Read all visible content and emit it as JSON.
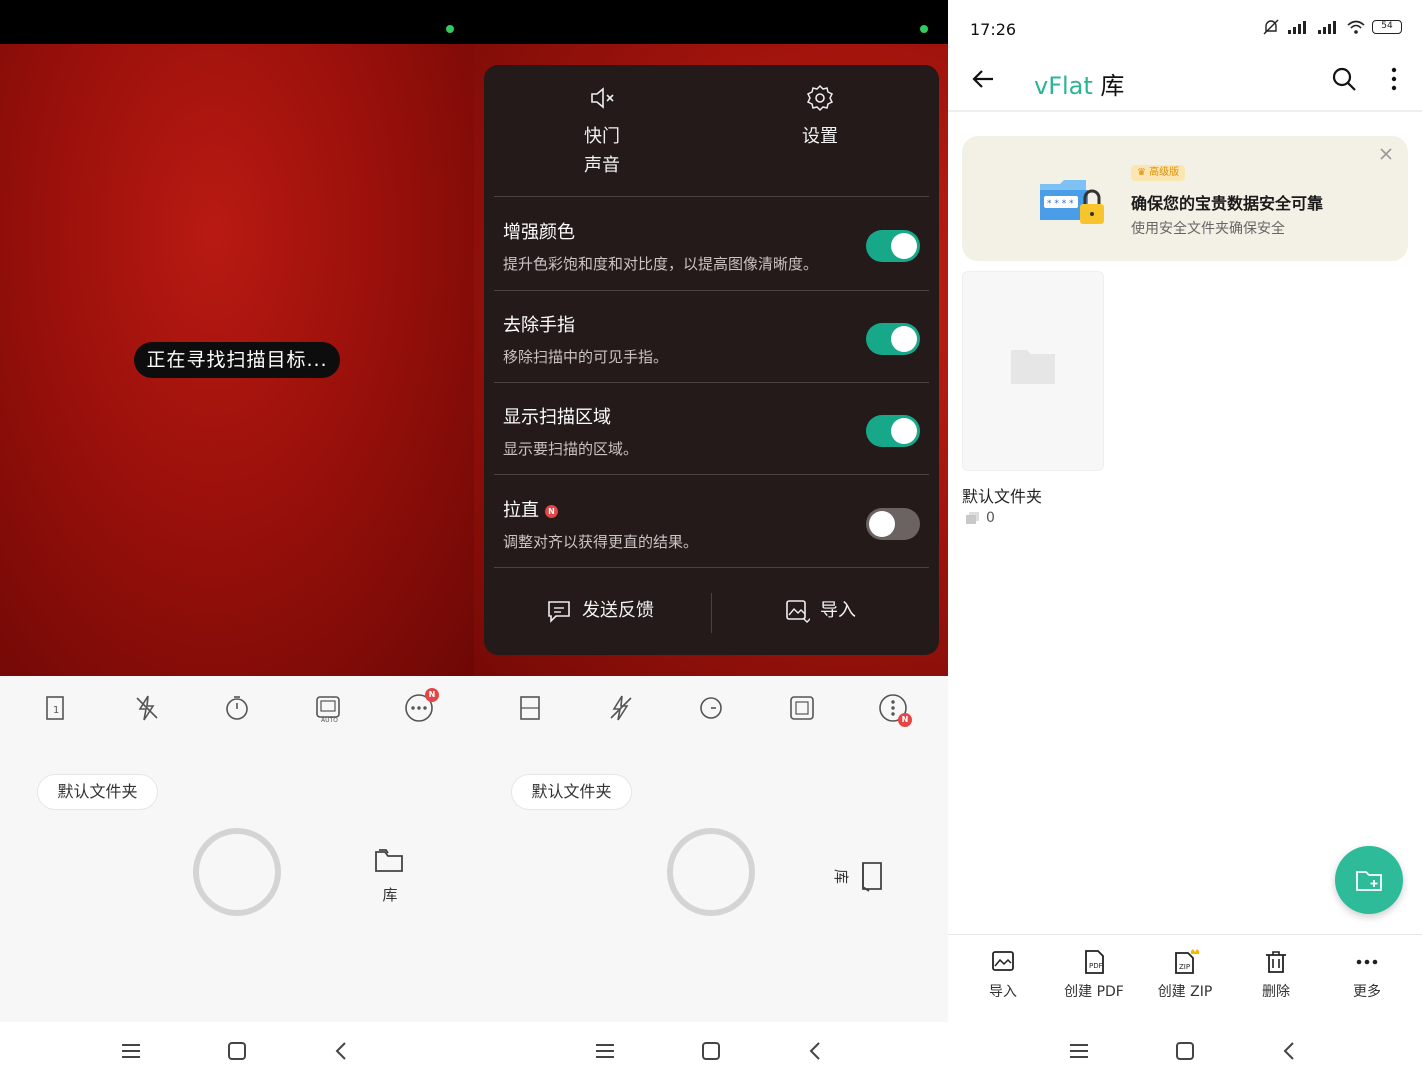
{
  "panel1": {
    "scan_status": "正在寻找扫描目标...",
    "folder_chip": "默认文件夹",
    "library_label": "库",
    "more_badge": "N",
    "tools": [
      "page-single-icon",
      "flash-off-icon",
      "timer-icon",
      "auto-capture-icon",
      "more-icon"
    ]
  },
  "panel2": {
    "menu": {
      "shutter_sound": "快门\n声音",
      "settings": "设置",
      "items": [
        {
          "title": "增强颜色",
          "desc": "提升色彩饱和度和对比度，以提高图像清晰度。",
          "on": true
        },
        {
          "title": "去除手指",
          "desc": "移除扫描中的可见手指。",
          "on": true
        },
        {
          "title": "显示扫描区域",
          "desc": "显示要扫描的区域。",
          "on": true
        },
        {
          "title": "拉直",
          "desc": "调整对齐以获得更直的结果。",
          "on": false,
          "badge": "N"
        }
      ],
      "feedback": "发送反馈",
      "import": "导入"
    },
    "folder_chip": "默认文件夹",
    "library_label": "库",
    "more_badge": "N"
  },
  "panel3": {
    "status": {
      "time": "17:26",
      "battery": "54"
    },
    "title_brand": "vFlat",
    "title_rest": " 库",
    "banner": {
      "badge": "高级版",
      "title": "确保您的宝贵数据安全可靠",
      "subtitle": "使用安全文件夹确保安全"
    },
    "folder": {
      "name": "默认文件夹",
      "count": "0"
    },
    "bottom_actions": [
      "导入",
      "创建 PDF",
      "创建 ZIP",
      "删除",
      "更多"
    ]
  },
  "colors": {
    "accent": "#2bb595",
    "toggle_on": "#17a88a",
    "badge": "#e64545",
    "menu_bg": "#231a19"
  }
}
